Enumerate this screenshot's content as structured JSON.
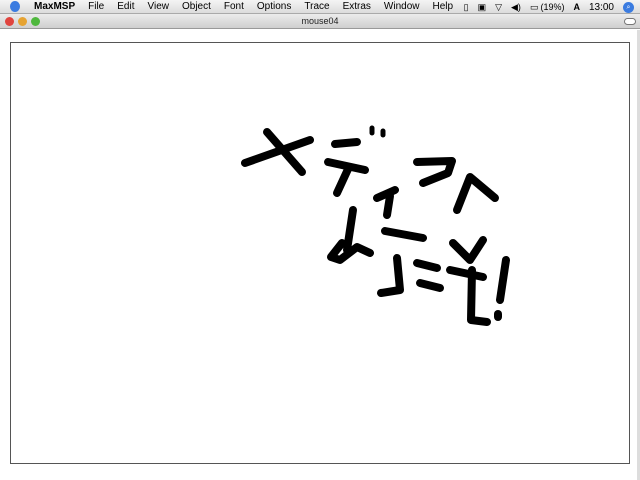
{
  "menubar": {
    "app": "MaxMSP",
    "items": [
      "File",
      "Edit",
      "View",
      "Object",
      "Font",
      "Options",
      "Trace",
      "Extras",
      "Window",
      "Help"
    ],
    "battery": "(19%)",
    "input_menu": "A",
    "clock": "13:00"
  },
  "window": {
    "title": "mouse04"
  },
  "colors": {
    "ink": "#000000",
    "close": "#e0443e",
    "minimize": "#e6a332",
    "zoom": "#4fb83d"
  }
}
